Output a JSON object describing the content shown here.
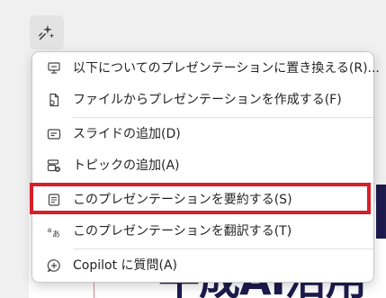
{
  "slide": {
    "heading_fragment": "牛成AI活用"
  },
  "copilot_button": {
    "icon": "copilot-sparkle-icon"
  },
  "menu": {
    "items": [
      {
        "icon": "slides-replace-icon",
        "label": "以下についてのプレゼンテーションに置き換える(R)..."
      },
      {
        "icon": "file-create-icon",
        "label": "ファイルからプレゼンテーションを作成する(F)"
      },
      {
        "icon": "add-slide-icon",
        "label": "スライドの追加(D)"
      },
      {
        "icon": "add-topic-icon",
        "label": "トピックの追加(A)"
      },
      {
        "icon": "summarize-icon",
        "label": "このプレゼンテーションを要約する(S)"
      },
      {
        "icon": "translate-icon",
        "label": "このプレゼンテーションを翻訳する(T)"
      },
      {
        "icon": "chat-question-icon",
        "label": "Copilot に質問(A)"
      }
    ]
  },
  "colors": {
    "highlight": "#d61f28",
    "slide_text": "#1e1a4d"
  }
}
